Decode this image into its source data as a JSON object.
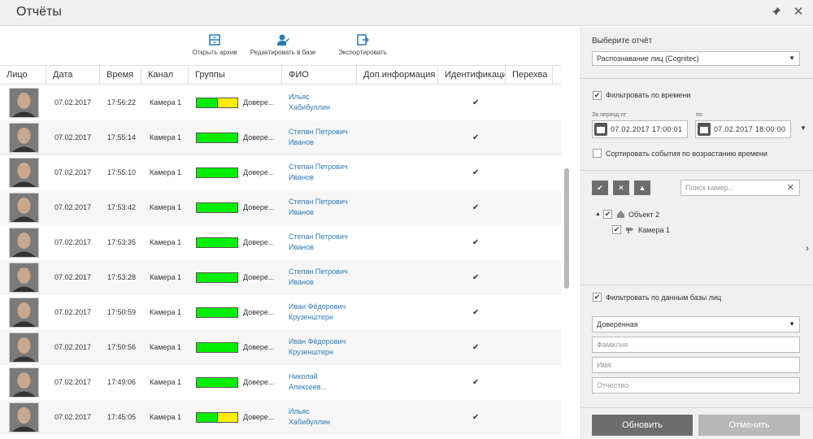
{
  "window": {
    "title": "Отчёты",
    "pin_icon": "pin-icon",
    "close_icon": "close-icon",
    "close_glyph": "✕",
    "pin_glyph": "✈"
  },
  "toolbar": {
    "open_archive": "Открыть архив",
    "edit_in_db": "Редактировать в базе",
    "export": "Экспортировать"
  },
  "table": {
    "headers": [
      "Лицо",
      "Дата",
      "Время",
      "Канал",
      "Группы",
      "ФИО",
      "Доп.информация",
      "Идентификаци",
      "Перехва"
    ],
    "rows": [
      {
        "date": "07.02.2017",
        "time": "17:56:22",
        "channel": "Камера 1",
        "group": "Довере...",
        "group_level": 0.5,
        "name1": "Ильяс",
        "name2": "Хабибуллин",
        "check": "✔"
      },
      {
        "date": "07.02.2017",
        "time": "17:55:14",
        "channel": "Камера 1",
        "group": "Довере...",
        "group_level": 1,
        "name1": "Степан Петрович",
        "name2": "Иванов",
        "check": "✔"
      },
      {
        "date": "07.02.2017",
        "time": "17:55:10",
        "channel": "Камера 1",
        "group": "Довере...",
        "group_level": 1,
        "name1": "Степан Петрович",
        "name2": "Иванов",
        "check": "✔"
      },
      {
        "date": "07.02.2017",
        "time": "17:53:42",
        "channel": "Камера 1",
        "group": "Довере...",
        "group_level": 1,
        "name1": "Степан Петрович",
        "name2": "Иванов",
        "check": "✔"
      },
      {
        "date": "07.02.2017",
        "time": "17:53:35",
        "channel": "Камера 1",
        "group": "Довере...",
        "group_level": 1,
        "name1": "Степан Петрович",
        "name2": "Иванов",
        "check": "✔"
      },
      {
        "date": "07.02.2017",
        "time": "17:53:28",
        "channel": "Камера 1",
        "group": "Довере...",
        "group_level": 1,
        "name1": "Степан Петрович",
        "name2": "Иванов",
        "check": "✔"
      },
      {
        "date": "07.02.2017",
        "time": "17:50:59",
        "channel": "Камера 1",
        "group": "Довере...",
        "group_level": 1,
        "name1": "Иван Фёдорович",
        "name2": "Крузенштерн",
        "check": "✔"
      },
      {
        "date": "07.02.2017",
        "time": "17:50:56",
        "channel": "Камера 1",
        "group": "Довере...",
        "group_level": 1,
        "name1": "Иван Фёдорович",
        "name2": "Крузенштерн",
        "check": "✔"
      },
      {
        "date": "07.02.2017",
        "time": "17:49:06",
        "channel": "Камера 1",
        "group": "Довере...",
        "group_level": 1,
        "name1": "Николай",
        "name2": "Алексеев...",
        "check": "✔"
      },
      {
        "date": "07.02.2017",
        "time": "17:45:05",
        "channel": "Камера 1",
        "group": "Довере...",
        "group_level": 0.5,
        "name1": "Ильяс",
        "name2": "Хабибуллин",
        "check": "✔"
      }
    ]
  },
  "panel": {
    "choose_report_label": "Выберите отчёт",
    "report_value": "Распознавание лиц (Cognitec)",
    "filter_time_label": "Фильтровать по времени",
    "period_from_label": "За период от",
    "period_to_label": "по",
    "from_value": "07.02.2017  17:00:01",
    "to_value": "07.02.2017  18:00:00",
    "sort_label": "Сортировать события по возрастанию времени",
    "camera_search_placeholder": "Поиск камер...",
    "tree_object": "Объект 2",
    "tree_camera": "Камера 1",
    "filter_db_label": "Фильтровать по данным базы лиц",
    "group_value": "Доверенная",
    "surname_placeholder": "Фамилия",
    "name_placeholder": "Имя",
    "patronymic_placeholder": "Отчество",
    "update_button": "Обновить",
    "cancel_button": "Отменить",
    "checkmark": "✔",
    "caret": "▼",
    "clear_glyph": "✕",
    "tree_toggle": "▲",
    "chevron_right": "›",
    "btn_check_glyph": "✔",
    "btn_x_glyph": "✕",
    "btn_up_glyph": "▲"
  },
  "colors": {
    "group_green": "#00ee00",
    "group_yellow": "#ffee00",
    "link_blue": "#2a7ab8"
  }
}
